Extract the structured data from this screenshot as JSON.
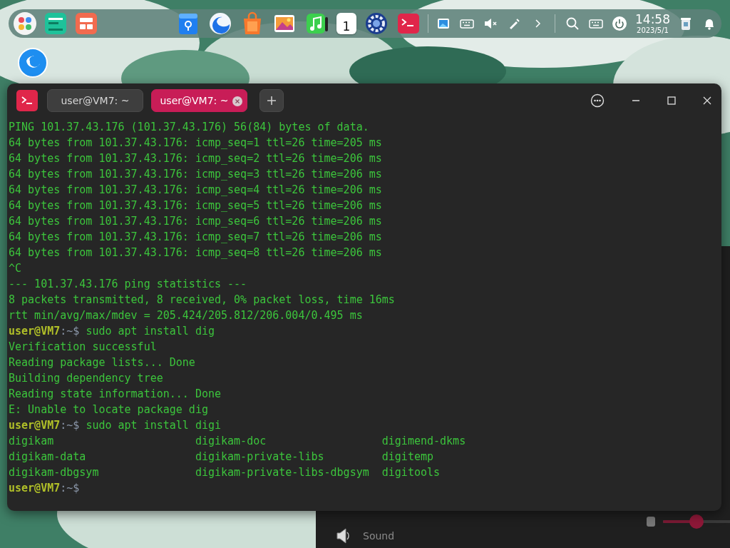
{
  "dock": {
    "calendar_day": "1",
    "clock": {
      "time": "14:58",
      "date": "2023/5/1"
    }
  },
  "terminal": {
    "tabs": [
      {
        "title": "user@VM7: ~",
        "selected": false
      },
      {
        "title": "user@VM7: ~",
        "selected": true
      }
    ],
    "lines": [
      {
        "kind": "output",
        "text": "PING 101.37.43.176 (101.37.43.176) 56(84) bytes of data."
      },
      {
        "kind": "output",
        "text": "64 bytes from 101.37.43.176: icmp_seq=1 ttl=26 time=205 ms"
      },
      {
        "kind": "output",
        "text": "64 bytes from 101.37.43.176: icmp_seq=2 ttl=26 time=206 ms"
      },
      {
        "kind": "output",
        "text": "64 bytes from 101.37.43.176: icmp_seq=3 ttl=26 time=206 ms"
      },
      {
        "kind": "output",
        "text": "64 bytes from 101.37.43.176: icmp_seq=4 ttl=26 time=206 ms"
      },
      {
        "kind": "output",
        "text": "64 bytes from 101.37.43.176: icmp_seq=5 ttl=26 time=206 ms"
      },
      {
        "kind": "output",
        "text": "64 bytes from 101.37.43.176: icmp_seq=6 ttl=26 time=206 ms"
      },
      {
        "kind": "output",
        "text": "64 bytes from 101.37.43.176: icmp_seq=7 ttl=26 time=206 ms"
      },
      {
        "kind": "output",
        "text": "64 bytes from 101.37.43.176: icmp_seq=8 ttl=26 time=206 ms"
      },
      {
        "kind": "output",
        "text": "^C"
      },
      {
        "kind": "output",
        "text": "--- 101.37.43.176 ping statistics ---"
      },
      {
        "kind": "output",
        "text": "8 packets transmitted, 8 received, 0% packet loss, time 16ms"
      },
      {
        "kind": "output",
        "text": "rtt min/avg/max/mdev = 205.424/205.812/206.004/0.495 ms"
      },
      {
        "kind": "prompt",
        "user": "user@VM7",
        "cwd": ":~$",
        "command": "sudo apt install dig"
      },
      {
        "kind": "output",
        "text": "Verification successful"
      },
      {
        "kind": "output",
        "text": "Reading package lists... Done"
      },
      {
        "kind": "output",
        "text": "Building dependency tree"
      },
      {
        "kind": "output",
        "text": "Reading state information... Done"
      },
      {
        "kind": "output",
        "text": "E: Unable to locate package dig"
      },
      {
        "kind": "prompt",
        "user": "user@VM7",
        "cwd": ":~$",
        "command": "sudo apt install digi"
      },
      {
        "kind": "columns",
        "cells": [
          "digikam",
          "digikam-doc",
          "digimend-dkms"
        ]
      },
      {
        "kind": "columns",
        "cells": [
          "digikam-data",
          "digikam-private-libs",
          "digitemp"
        ]
      },
      {
        "kind": "columns",
        "cells": [
          "digikam-dbgsym",
          "digikam-private-libs-dbgsym",
          "digitools"
        ]
      },
      {
        "kind": "prompt",
        "user": "user@VM7",
        "cwd": ":~$"
      }
    ]
  },
  "settings_window": {
    "item": "Sound",
    "volume": {
      "level": 0.5
    }
  }
}
